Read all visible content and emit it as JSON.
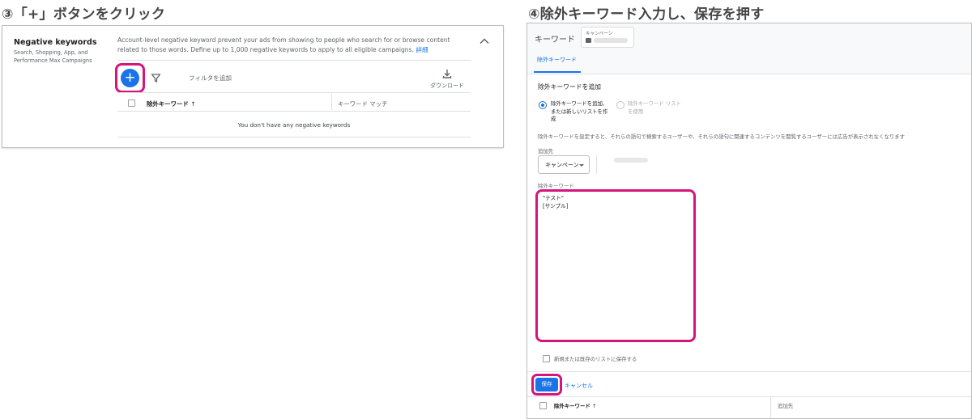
{
  "steps": {
    "step3_title": "③「+」ボタンをクリック",
    "step4_title": "④除外キーワード入力し、保存を押す"
  },
  "left_panel": {
    "side_title": "Negative keywords",
    "side_subtitle": "Search, Shopping, App, and Performance Max Campaigns",
    "description": "Account-level negative keyword prevent your ads from showing to people who search for or browse content related to those words. Define up to 1,000 negative keywords to apply to all eligible campaigns.",
    "details_link": "詳細",
    "add_button_label": "+",
    "filter_label": "フィルタを追加",
    "download_label": "ダウンロード",
    "table_headers": [
      "除外キーワード",
      "キーワード マッチ"
    ],
    "sort_indicator": "↑",
    "empty_message": "You don't have any negative keywords"
  },
  "right_panel": {
    "tab_title": "キーワード",
    "campaign_chip_label": "キャンペーン",
    "sub_tab": "除外キーワード",
    "section_title": "除外キーワードを追加",
    "radio_options": [
      {
        "label": "除外キーワードを追加、または新しいリストを作成",
        "selected": true
      },
      {
        "label": "除外キーワード リストを使用",
        "selected": false
      }
    ],
    "notice": "除外キーワードを設定すると、それらの語句で検索するユーザーや、それらの語句に関連するコンテンツを閲覧するユーザーには広告が表示されなくなります",
    "add_to_label": "追加先",
    "add_to_value": "キャンペーン",
    "keywords_label": "除外キーワード",
    "keywords_value": "\"テスト\"\n[サンプル]",
    "save_checkbox_label": "新規または既存のリストに保存する",
    "save_button": "保存",
    "cancel_button": "キャンセル",
    "table_headers": [
      "除外キーワード",
      "追加先"
    ],
    "sort_indicator": "↑"
  },
  "colors": {
    "accent": "#1a73e8",
    "highlight": "#d6147e"
  }
}
